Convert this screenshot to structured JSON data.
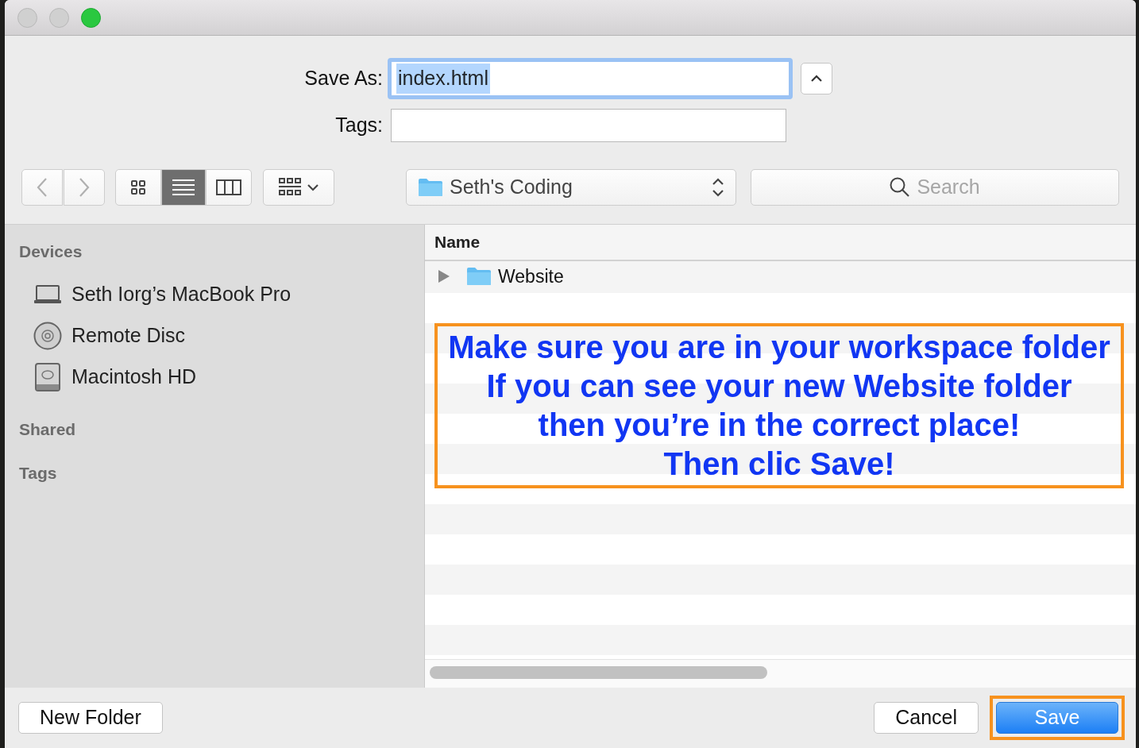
{
  "window": {
    "traffic_lights": [
      {
        "active": false
      },
      {
        "active": false
      },
      {
        "active": true
      }
    ]
  },
  "save_as": {
    "label": "Save As:",
    "value": "index.html",
    "text_selected": true,
    "focused": true
  },
  "expand_button": {
    "expanded": true
  },
  "tags_field": {
    "label": "Tags:"
  },
  "view_modes": [
    {
      "kind": "icons",
      "selected": false
    },
    {
      "kind": "list",
      "selected": true
    },
    {
      "kind": "columns",
      "selected": false
    }
  ],
  "location": "Seth's Coding",
  "search": {
    "placeholder": "Search"
  },
  "sidebar": [
    {
      "title": "Devices",
      "items": [
        {
          "kind": "laptop",
          "label": "Seth Iorg’s MacBook Pro"
        },
        {
          "kind": "disc",
          "label": "Remote Disc"
        },
        {
          "kind": "disk",
          "label": "Macintosh HD"
        }
      ]
    },
    {
      "title": "Shared"
    },
    {
      "title": "Tags"
    }
  ],
  "file_list": {
    "columns": [
      "Name"
    ],
    "rows": [
      {
        "kind": "folder",
        "name": "Website",
        "expanded": false
      }
    ]
  },
  "annotation": [
    "Make sure you are in your workspace folder",
    "If you can see your new Website folder",
    "then you’re in the correct place!",
    "Then clic Save!"
  ],
  "buttons": [
    {
      "label": "New Folder",
      "default": false,
      "highlighted": false
    },
    {
      "label": "Cancel",
      "default": false,
      "highlighted": false
    },
    {
      "label": "Save",
      "default": true,
      "highlighted": true
    }
  ]
}
